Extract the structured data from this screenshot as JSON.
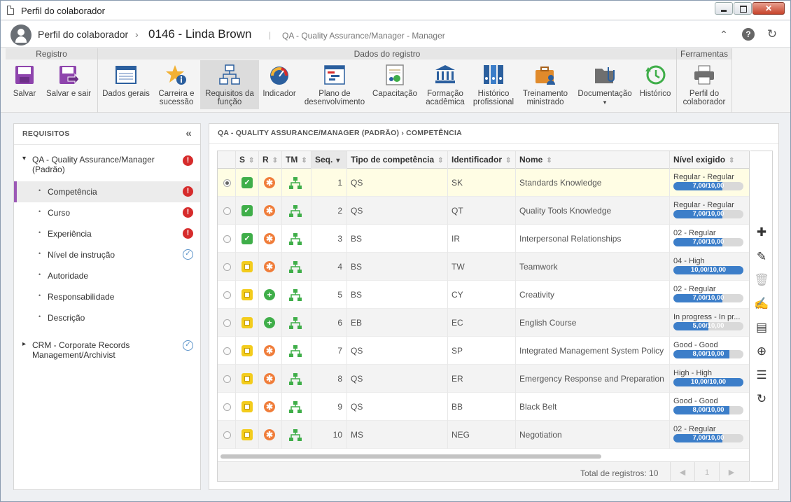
{
  "window": {
    "title": "Perfil do colaborador",
    "close_glyph": "✕"
  },
  "header": {
    "module": "Perfil do colaborador",
    "separator": "›",
    "record": "0146 - Linda Brown",
    "divider": "|",
    "role": "QA - Quality Assurance/Manager - Manager",
    "icons": {
      "collapse": "double-chevron-up-icon",
      "help": "help-icon",
      "refresh": "refresh-icon"
    },
    "help_glyph": "?",
    "collapse_glyph": "⌃",
    "refresh_glyph": "↻"
  },
  "ribbon": {
    "groups": {
      "registro": "Registro",
      "dados": "Dados do registro",
      "ferramentas": "Ferramentas"
    },
    "buttons": [
      {
        "label": "Salvar",
        "icon": "save-icon"
      },
      {
        "label": "Salvar e sair",
        "icon": "save-exit-icon"
      },
      {
        "label": "Dados gerais",
        "icon": "form-icon"
      },
      {
        "label": "Carreira e sucessão",
        "icon": "career-star-icon"
      },
      {
        "label": "Requisitos da função",
        "icon": "org-chart-icon"
      },
      {
        "label": "Indicador",
        "icon": "gauge-icon"
      },
      {
        "label": "Plano de desenvolvimento",
        "icon": "gantt-icon"
      },
      {
        "label": "Capacitação",
        "icon": "certificate-icon"
      },
      {
        "label": "Formação acadêmica",
        "icon": "academy-icon"
      },
      {
        "label": "Histórico profissional",
        "icon": "binders-icon"
      },
      {
        "label": "Treinamento ministrado",
        "icon": "briefcase-user-icon"
      },
      {
        "label": "Documentação",
        "icon": "folder-clip-icon"
      },
      {
        "label": "Histórico",
        "icon": "history-icon"
      },
      {
        "label": "Perfil do colaborador",
        "icon": "printer-icon"
      }
    ],
    "dropdown_glyph": "▾"
  },
  "left": {
    "title": "REQUISITOS",
    "collapse_glyph": "«",
    "tree": [
      {
        "label": "QA - Quality Assurance/Manager (Padrão)",
        "status": "error"
      },
      {
        "label": "Competência",
        "status": "error",
        "selected": true
      },
      {
        "label": "Curso",
        "status": "error"
      },
      {
        "label": "Experiência",
        "status": "error"
      },
      {
        "label": "Nível de instrução",
        "status": "ok"
      },
      {
        "label": "Autoridade",
        "status": ""
      },
      {
        "label": "Responsabilidade",
        "status": ""
      },
      {
        "label": "Descrição",
        "status": ""
      },
      {
        "label": "CRM - Corporate Records Management/Archivist",
        "status": "ok"
      }
    ],
    "bullet": "•",
    "expand_open": "▾",
    "expand_closed": "▸",
    "err_glyph": "!",
    "ok_glyph": "✓"
  },
  "main": {
    "breadcrumb": "QA - QUALITY ASSURANCE/MANAGER (PADRÃO)  ›  COMPETÊNCIA",
    "columns": {
      "s": "S",
      "r": "R",
      "tm": "TM",
      "seq": "Seq.",
      "tipo": "Tipo de competência",
      "id": "Identificador",
      "nome": "Nome",
      "nivel": "Nível exigido"
    },
    "sort_glyph": "⇕",
    "sort_active_glyph": "▾",
    "rows": [
      {
        "seq": "1",
        "tipo": "QS",
        "id": "SK",
        "nome": "Standards Knowledge",
        "nivel": "Regular - Regular",
        "bar": "7,00/10,00",
        "fill": 0.7,
        "s": "ok",
        "r": "star",
        "selected": true
      },
      {
        "seq": "2",
        "tipo": "QS",
        "id": "QT",
        "nome": "Quality Tools Knowledge",
        "nivel": "Regular - Regular",
        "bar": "7,00/10,00",
        "fill": 0.7,
        "s": "ok",
        "r": "star"
      },
      {
        "seq": "3",
        "tipo": "BS",
        "id": "IR",
        "nome": "Interpersonal Relationships",
        "nivel": "02 - Regular",
        "bar": "7,00/10,00",
        "fill": 0.7,
        "s": "ok",
        "r": "star"
      },
      {
        "seq": "4",
        "tipo": "BS",
        "id": "TW",
        "nome": "Teamwork",
        "nivel": "04 - High",
        "bar": "10,00/10,00",
        "fill": 1.0,
        "s": "pend",
        "r": "star"
      },
      {
        "seq": "5",
        "tipo": "BS",
        "id": "CY",
        "nome": "Creativity",
        "nivel": "02 - Regular",
        "bar": "7,00/10,00",
        "fill": 0.7,
        "s": "pend",
        "r": "plus"
      },
      {
        "seq": "6",
        "tipo": "EB",
        "id": "EC",
        "nome": "English Course",
        "nivel": "In progress - In pr...",
        "bar": "5,00/10,00",
        "fill": 0.5,
        "s": "pend",
        "r": "plus"
      },
      {
        "seq": "7",
        "tipo": "QS",
        "id": "SP",
        "nome": "Integrated Management System Policy",
        "nivel": "Good - Good",
        "bar": "8,00/10,00",
        "fill": 0.8,
        "s": "pend",
        "r": "star"
      },
      {
        "seq": "8",
        "tipo": "QS",
        "id": "ER",
        "nome": "Emergency Response and Preparation",
        "nivel": "High - High",
        "bar": "10,00/10,00",
        "fill": 1.0,
        "s": "pend",
        "r": "star"
      },
      {
        "seq": "9",
        "tipo": "QS",
        "id": "BB",
        "nome": "Black Belt",
        "nivel": "Good - Good",
        "bar": "8,00/10,00",
        "fill": 0.8,
        "s": "pend",
        "r": "star"
      },
      {
        "seq": "10",
        "tipo": "MS",
        "id": "NEG",
        "nome": "Negotiation",
        "nivel": "02 - Regular",
        "bar": "7,00/10,00",
        "fill": 0.7,
        "s": "pend",
        "r": "star"
      }
    ],
    "footer": {
      "total": "Total de registros: 10",
      "page": "1",
      "prev": "◀",
      "next": "▶"
    },
    "side_tools": [
      {
        "name": "add-icon",
        "glyph": "✚"
      },
      {
        "name": "edit-icon",
        "glyph": "✎"
      },
      {
        "name": "delete-icon",
        "glyph": "🗑"
      },
      {
        "name": "evaluate-icon",
        "glyph": "✍"
      },
      {
        "name": "certificate-view-icon",
        "glyph": "▤"
      },
      {
        "name": "target-icon",
        "glyph": "⊕"
      },
      {
        "name": "list-icon",
        "glyph": "☰"
      },
      {
        "name": "reload-icon",
        "glyph": "↻"
      }
    ]
  }
}
